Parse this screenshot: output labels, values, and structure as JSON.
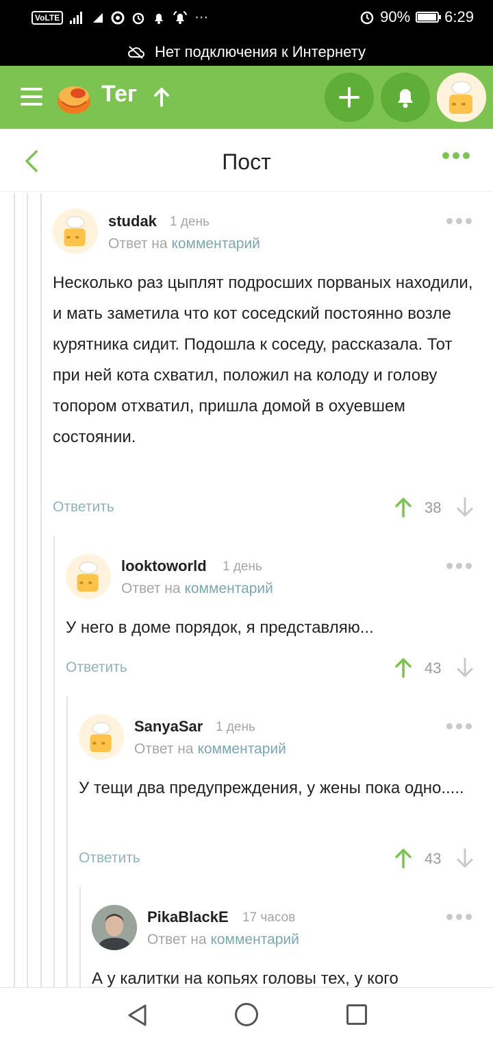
{
  "status_bar": {
    "network_badge": "VoLTE",
    "battery": "90%",
    "time": "6:29",
    "battery_level": 0.9
  },
  "offline_banner": {
    "text": "Нет подключения к Интернету"
  },
  "app_bar": {
    "title": "Тег",
    "accent_color": "#7cc352"
  },
  "header": {
    "title": "Пост"
  },
  "comments": [
    {
      "author": "studak",
      "time": "1 день",
      "reply_prefix": "Ответ на",
      "reply_link": "комментарий",
      "text": "Несколько раз цыплят подросших порваных находили, и мать заметила что кот соседский постоянно возле курятника сидит.  Подошла к соседу, рассказала.  Тот при ней кота схватил, положил на колоду и голову топором отхватил,  пришла домой в охуевшем состоянии.",
      "reply_label": "Ответить",
      "rating": "38",
      "avatar": "default-avatar"
    },
    {
      "author": "looktoworld",
      "time": "1 день",
      "reply_prefix": "Ответ на",
      "reply_link": "комментарий",
      "text": "У него в доме порядок, я представляю...",
      "reply_label": "Ответить",
      "rating": "43",
      "avatar": "default-avatar"
    },
    {
      "author": "SanyaSar",
      "time": "1 день",
      "reply_prefix": "Ответ на",
      "reply_link": "комментарий",
      "text": "У тещи два предупреждения, у жены пока одно.....",
      "reply_label": "Ответить",
      "rating": "43",
      "avatar": "default-avatar"
    },
    {
      "author": "PikaBlackE",
      "time": "17 часов",
      "reply_prefix": "Ответ на",
      "reply_link": "комментарий",
      "text": "А у калитки на копьях головы тех, у кого",
      "avatar": "user-photo"
    }
  ]
}
